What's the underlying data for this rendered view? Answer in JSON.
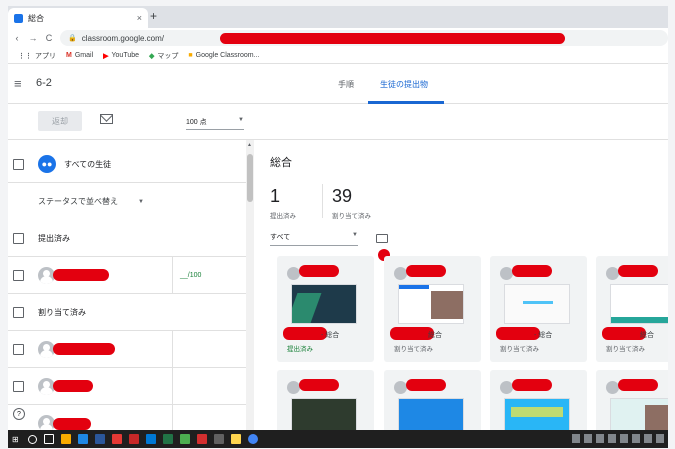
{
  "browser": {
    "tab_title": "総合",
    "tab_close": "×",
    "new_tab": "+",
    "url": "classroom.google.com/",
    "bookmarks": [
      {
        "label": "アプリ",
        "icon": "apps-icon"
      },
      {
        "label": "Gmail",
        "icon": "gmail-icon"
      },
      {
        "label": "YouTube",
        "icon": "youtube-icon"
      },
      {
        "label": "マップ",
        "icon": "maps-icon"
      },
      {
        "label": "Google Classroom...",
        "icon": "classroom-icon"
      }
    ]
  },
  "header": {
    "class_name": "6-2",
    "tabs": [
      {
        "label": "手順"
      },
      {
        "label": "生徒の提出物"
      }
    ]
  },
  "toolbar": {
    "return_label": "返却",
    "points_value": "100 点"
  },
  "student_list": {
    "all_students": "すべての生徒",
    "sort_label": "ステータスで並べ替え",
    "sections": [
      "提出済み",
      "割り当て済み"
    ],
    "grade_placeholder": "__/100"
  },
  "panel": {
    "title": "総合",
    "submitted_count": "1",
    "submitted_label": "提出済み",
    "assigned_count": "39",
    "assigned_label": "割り当て済み",
    "filter_label": "すべて"
  },
  "cards": [
    {
      "title": "- 総合",
      "status": "提出済み"
    },
    {
      "title": "総合",
      "status": "割り当て済み"
    },
    {
      "title": "- 総合",
      "status": "割り当て済み"
    },
    {
      "title": "総合",
      "status": "割り当て済み"
    }
  ],
  "colors": {
    "accent": "#1967d2",
    "redaction": "#e3000f",
    "submitted": "#188038"
  }
}
